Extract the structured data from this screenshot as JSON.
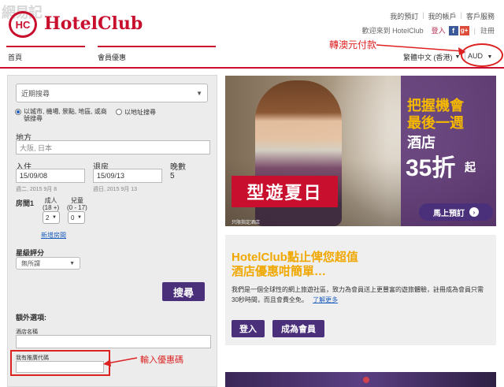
{
  "header": {
    "watermark": "網易記",
    "logo_mark": "HC",
    "logo_text": "HotelClub",
    "top_links": [
      "我的預訂",
      "我的帳戶",
      "客戶服務"
    ],
    "welcome": "歡迎來到 HotelClub",
    "login": "登入",
    "fb": "f",
    "gplus": "g+",
    "logout": "註冊",
    "nav": {
      "home": "首頁",
      "deals": "會員優惠"
    },
    "language": "繁體中文 (香港)",
    "currency": "AUD"
  },
  "annotations": {
    "currency": "轉澳元付款",
    "promo": "輸入優惠碼"
  },
  "search": {
    "recent": "近期搜尋",
    "radio_city": "以城市, 機場, 景點, 地區, 或商\n號搜尋",
    "radio_address": "以地址搜尋",
    "destination_label": "地方",
    "destination_placeholder": "大阪, 日本",
    "checkin_label": "入住",
    "checkin_value": "15/09/08",
    "checkin_sub": "週二, 2015 9月 8",
    "checkout_label": "退房",
    "checkout_value": "15/09/13",
    "checkout_sub": "週日, 2015 9月 13",
    "nights_label": "晚數",
    "nights_value": "5",
    "room_label": "房間1",
    "adult_label": "成人\n(18 +)",
    "child_label": "兒童\n(0 - 17)",
    "adult_value": "2",
    "child_value": "0",
    "add_room": "新增房間",
    "star_label": "星級評分",
    "star_value": "無所謂",
    "search_button": "搜尋",
    "extra_label": "額外選項:",
    "hotel_name_label": "酒店名稱",
    "promo_label": "我有推廣代碼"
  },
  "banner": {
    "line1": "把握機會",
    "line2": "最後一週",
    "line3": "酒店",
    "big": "35折",
    "qi": "起",
    "tag": "型遊夏日",
    "book": "馬上預訂",
    "fine": "只限指定酒店"
  },
  "marketing": {
    "title1": "HotelClub點止俾您超值",
    "title2": "酒店優惠咁簡單…",
    "body": "我們是一個全球性的網上旅遊社區，致力為會員送上更豐富的遊旅體驗，註冊成為會員只需30秒時間，而且會費全免。",
    "more": "了解更多",
    "login": "登入",
    "join": "成為會員"
  },
  "colors": {
    "brand_red": "#c8102e",
    "purple": "#4a2f7a",
    "gold": "#f0a800",
    "annotation_red": "#d22"
  }
}
